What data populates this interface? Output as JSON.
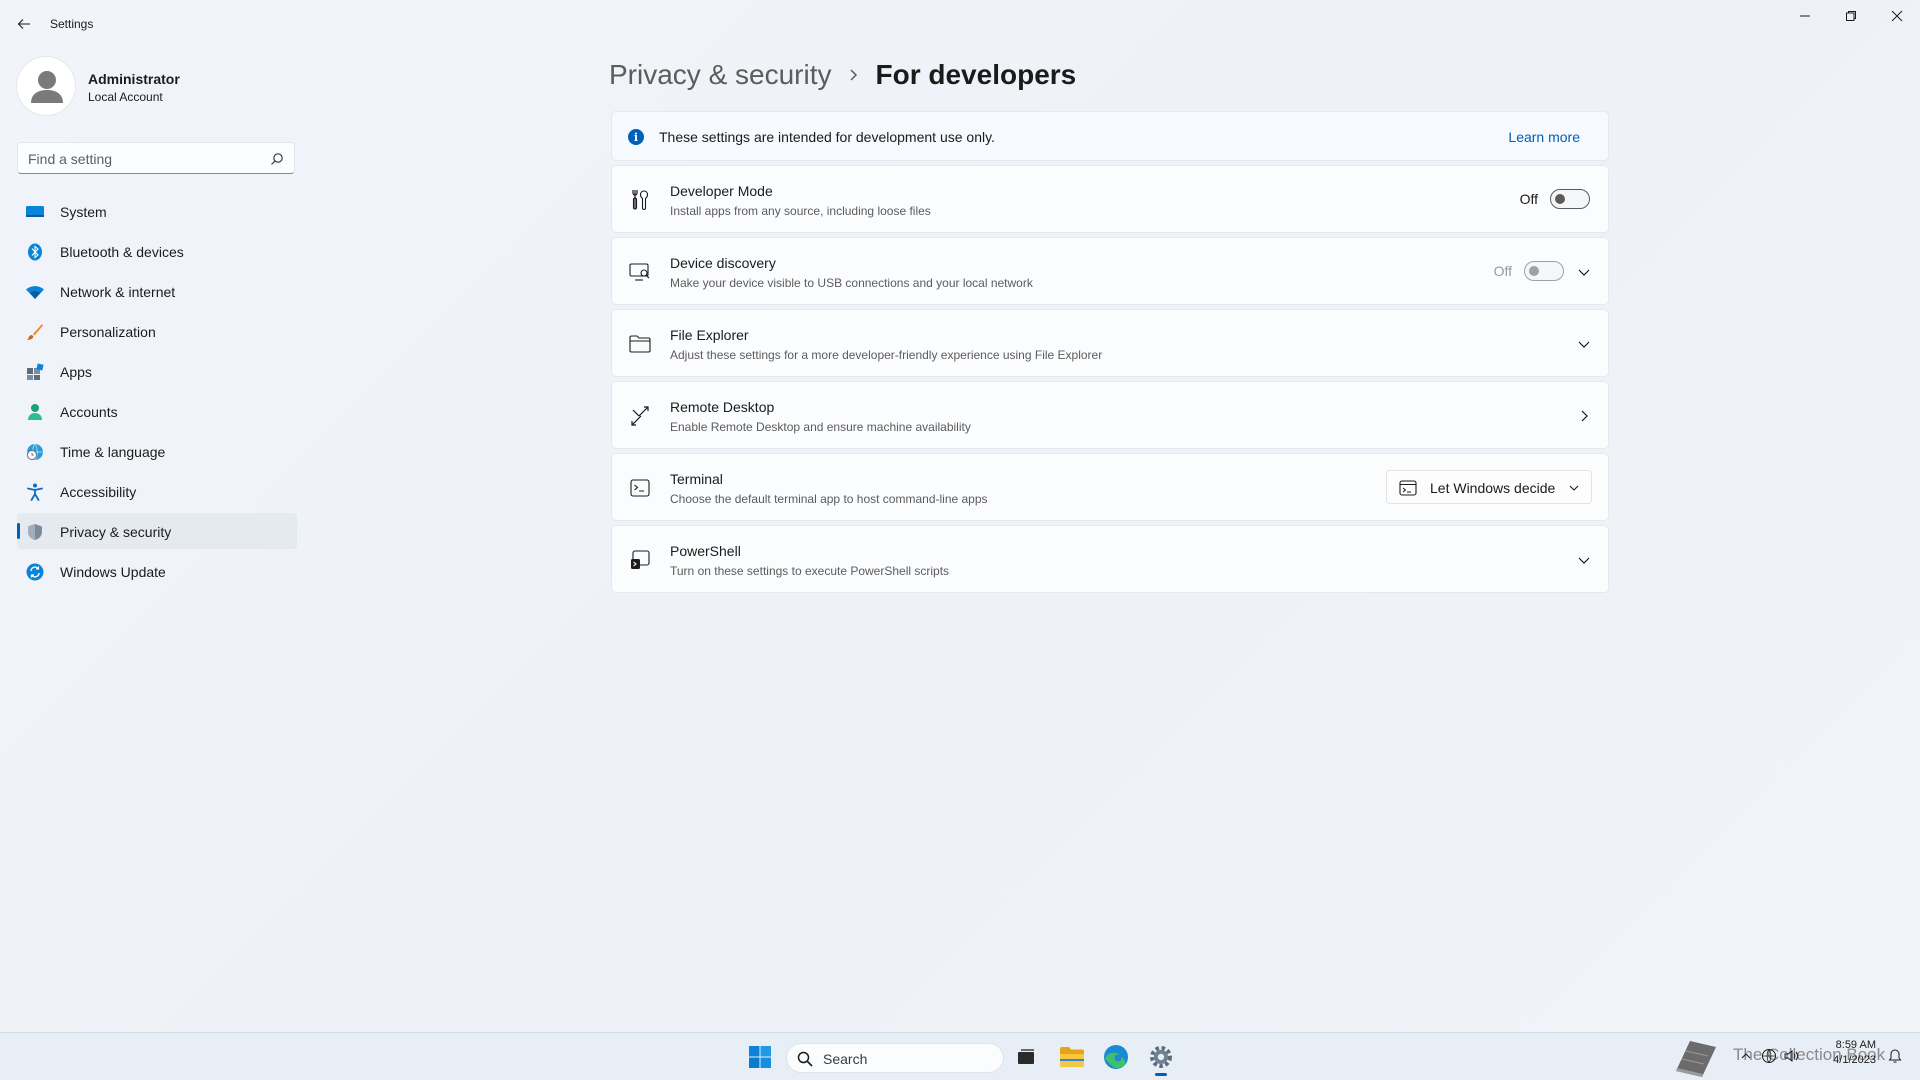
{
  "window": {
    "app_title": "Settings"
  },
  "profile": {
    "name": "Administrator",
    "account_type": "Local Account"
  },
  "search": {
    "placeholder": "Find a setting"
  },
  "sidebar": {
    "items": [
      {
        "label": "System",
        "icon": "system-icon"
      },
      {
        "label": "Bluetooth & devices",
        "icon": "bluetooth-icon"
      },
      {
        "label": "Network & internet",
        "icon": "wifi-icon"
      },
      {
        "label": "Personalization",
        "icon": "brush-icon"
      },
      {
        "label": "Apps",
        "icon": "apps-icon"
      },
      {
        "label": "Accounts",
        "icon": "person-icon"
      },
      {
        "label": "Time & language",
        "icon": "globe-clock-icon"
      },
      {
        "label": "Accessibility",
        "icon": "accessibility-icon"
      },
      {
        "label": "Privacy & security",
        "icon": "shield-icon",
        "selected": true
      },
      {
        "label": "Windows Update",
        "icon": "update-icon"
      }
    ]
  },
  "breadcrumb": {
    "parent": "Privacy & security",
    "current": "For developers"
  },
  "info_bar": {
    "text": "These settings are intended for development use only.",
    "link": "Learn more"
  },
  "settings": [
    {
      "title": "Developer Mode",
      "subtitle": "Install apps from any source, including loose files",
      "icon": "developer-tools-icon",
      "control": "toggle",
      "state_label": "Off",
      "enabled": true
    },
    {
      "title": "Device discovery",
      "subtitle": "Make your device visible to USB connections and your local network",
      "icon": "device-discovery-icon",
      "control": "toggle-expand",
      "state_label": "Off",
      "enabled": false
    },
    {
      "title": "File Explorer",
      "subtitle": "Adjust these settings for a more developer-friendly experience using File Explorer",
      "icon": "folder-icon",
      "control": "expand"
    },
    {
      "title": "Remote Desktop",
      "subtitle": "Enable Remote Desktop and ensure machine availability",
      "icon": "remote-desktop-icon",
      "control": "navigate"
    },
    {
      "title": "Terminal",
      "subtitle": "Choose the default terminal app to host command-line apps",
      "icon": "terminal-icon",
      "control": "dropdown",
      "selected_option": "Let Windows decide"
    },
    {
      "title": "PowerShell",
      "subtitle": "Turn on these settings to execute PowerShell scripts",
      "icon": "powershell-icon",
      "control": "expand"
    }
  ],
  "taskbar": {
    "search_label": "Search",
    "watermark": "The Collection Book",
    "time": "8:59 AM",
    "date": "4/1/2023"
  },
  "colors": {
    "accent": "#005fb8",
    "background": "#eef3f9",
    "card": "#fbfcfe"
  }
}
